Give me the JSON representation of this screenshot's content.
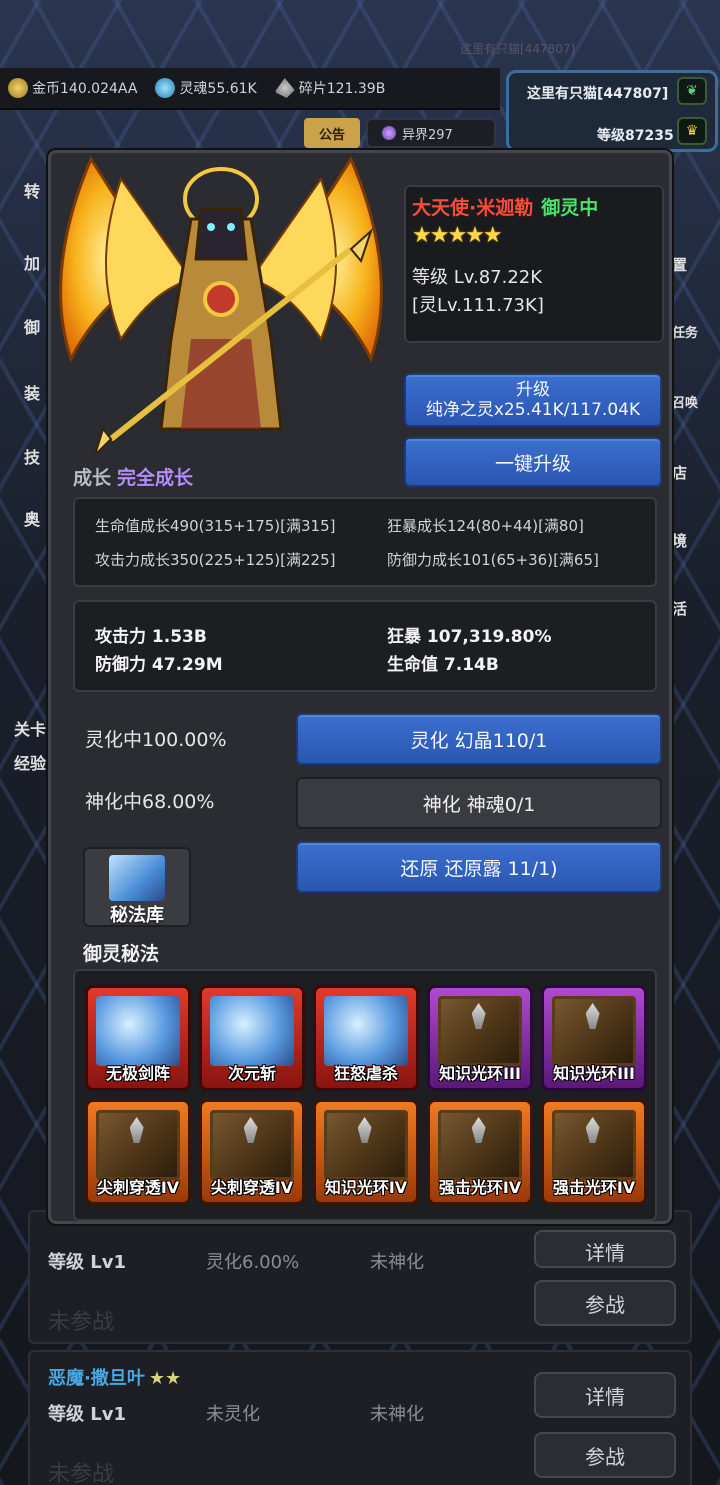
{
  "top_faint_text": "这里有只猫[447807]",
  "resources": [
    {
      "icon": "coin-icon",
      "label": "金币140.024AA"
    },
    {
      "icon": "soul-icon",
      "label": "灵魂55.61K"
    },
    {
      "icon": "fragment-icon",
      "label": "碎片121.39B"
    }
  ],
  "player": {
    "name": "这里有只猫[447807]",
    "level": "等级87235"
  },
  "tabs": {
    "notice": "公告",
    "realm": "异界297"
  },
  "left_side_items": [
    "转",
    "加",
    "御",
    "装",
    "技",
    "奥",
    "关卡",
    "经验"
  ],
  "right_side_items": [
    "置",
    "任务",
    "召唤",
    "店",
    "境",
    "活"
  ],
  "hero": {
    "name": "大天使·米迦勒",
    "status": "御灵中",
    "stars": "★★★★★",
    "level": "等级 Lv.87.22K",
    "spirit_level": "[灵Lv.111.73K]"
  },
  "upgrade": {
    "title": "升级",
    "cost": "纯净之灵x25.41K/117.04K"
  },
  "one_click_upgrade": "一键升级",
  "growth": {
    "label": "成长",
    "value": "完全成长",
    "items": [
      "生命值成长490(315+175)[满315]",
      "狂暴成长124(80+44)[满80]",
      "攻击力成长350(225+125)[满225]",
      "防御力成长101(65+36)[满65]"
    ]
  },
  "stats": {
    "attack": "攻击力 1.53B",
    "defense": "防御力 47.29M",
    "berserk": "狂暴 107,319.80%",
    "hp": "生命值 7.14B"
  },
  "transform": {
    "spiritualize_status": "灵化中100.00%",
    "spiritualize_button": "灵化 幻晶110/1",
    "deify_status": "神化中68.00%",
    "deify_button": "神化 神魂0/1",
    "restore_button": "还原 还原露 11/1)"
  },
  "library_label": "秘法库",
  "skills_title": "御灵秘法",
  "skills": [
    {
      "label": "无极剑阵",
      "frame": "red",
      "icon": "blue-tome-icon"
    },
    {
      "label": "次元斩",
      "frame": "red",
      "icon": "blue-tome-icon"
    },
    {
      "label": "狂怒虐杀",
      "frame": "red",
      "icon": "blue-tome-icon"
    },
    {
      "label": "知识光环III",
      "frame": "purple",
      "icon": "spike-book-icon"
    },
    {
      "label": "知识光环III",
      "frame": "purple",
      "icon": "spike-book-icon"
    },
    {
      "label": "尖刺穿透IV",
      "frame": "orange",
      "icon": "spike-book-icon"
    },
    {
      "label": "尖刺穿透IV",
      "frame": "orange",
      "icon": "spike-book-icon"
    },
    {
      "label": "知识光环IV",
      "frame": "orange",
      "icon": "spike-book-icon"
    },
    {
      "label": "强击光环IV",
      "frame": "orange",
      "icon": "spike-book-icon"
    },
    {
      "label": "强击光环IV",
      "frame": "orange",
      "icon": "spike-book-icon"
    }
  ],
  "list": [
    {
      "name": "",
      "stars": "",
      "level": "等级 Lv1",
      "ling": "灵化6.00%",
      "shen": "未神化",
      "state": "未参战",
      "detail": "详情",
      "join": "参战"
    },
    {
      "name": "恶魔·撒旦叶",
      "stars": "★★",
      "level": "等级 Lv1",
      "ling": "未灵化",
      "shen": "未神化",
      "state": "未参战",
      "detail": "详情",
      "join": "参战"
    }
  ],
  "colors": {
    "accent_blue": "#2f5fc0",
    "name_red": "#ff4a3a",
    "status_green": "#4be36a",
    "growth_purple": "#b58cff",
    "star_gold": "#ffd84a"
  }
}
